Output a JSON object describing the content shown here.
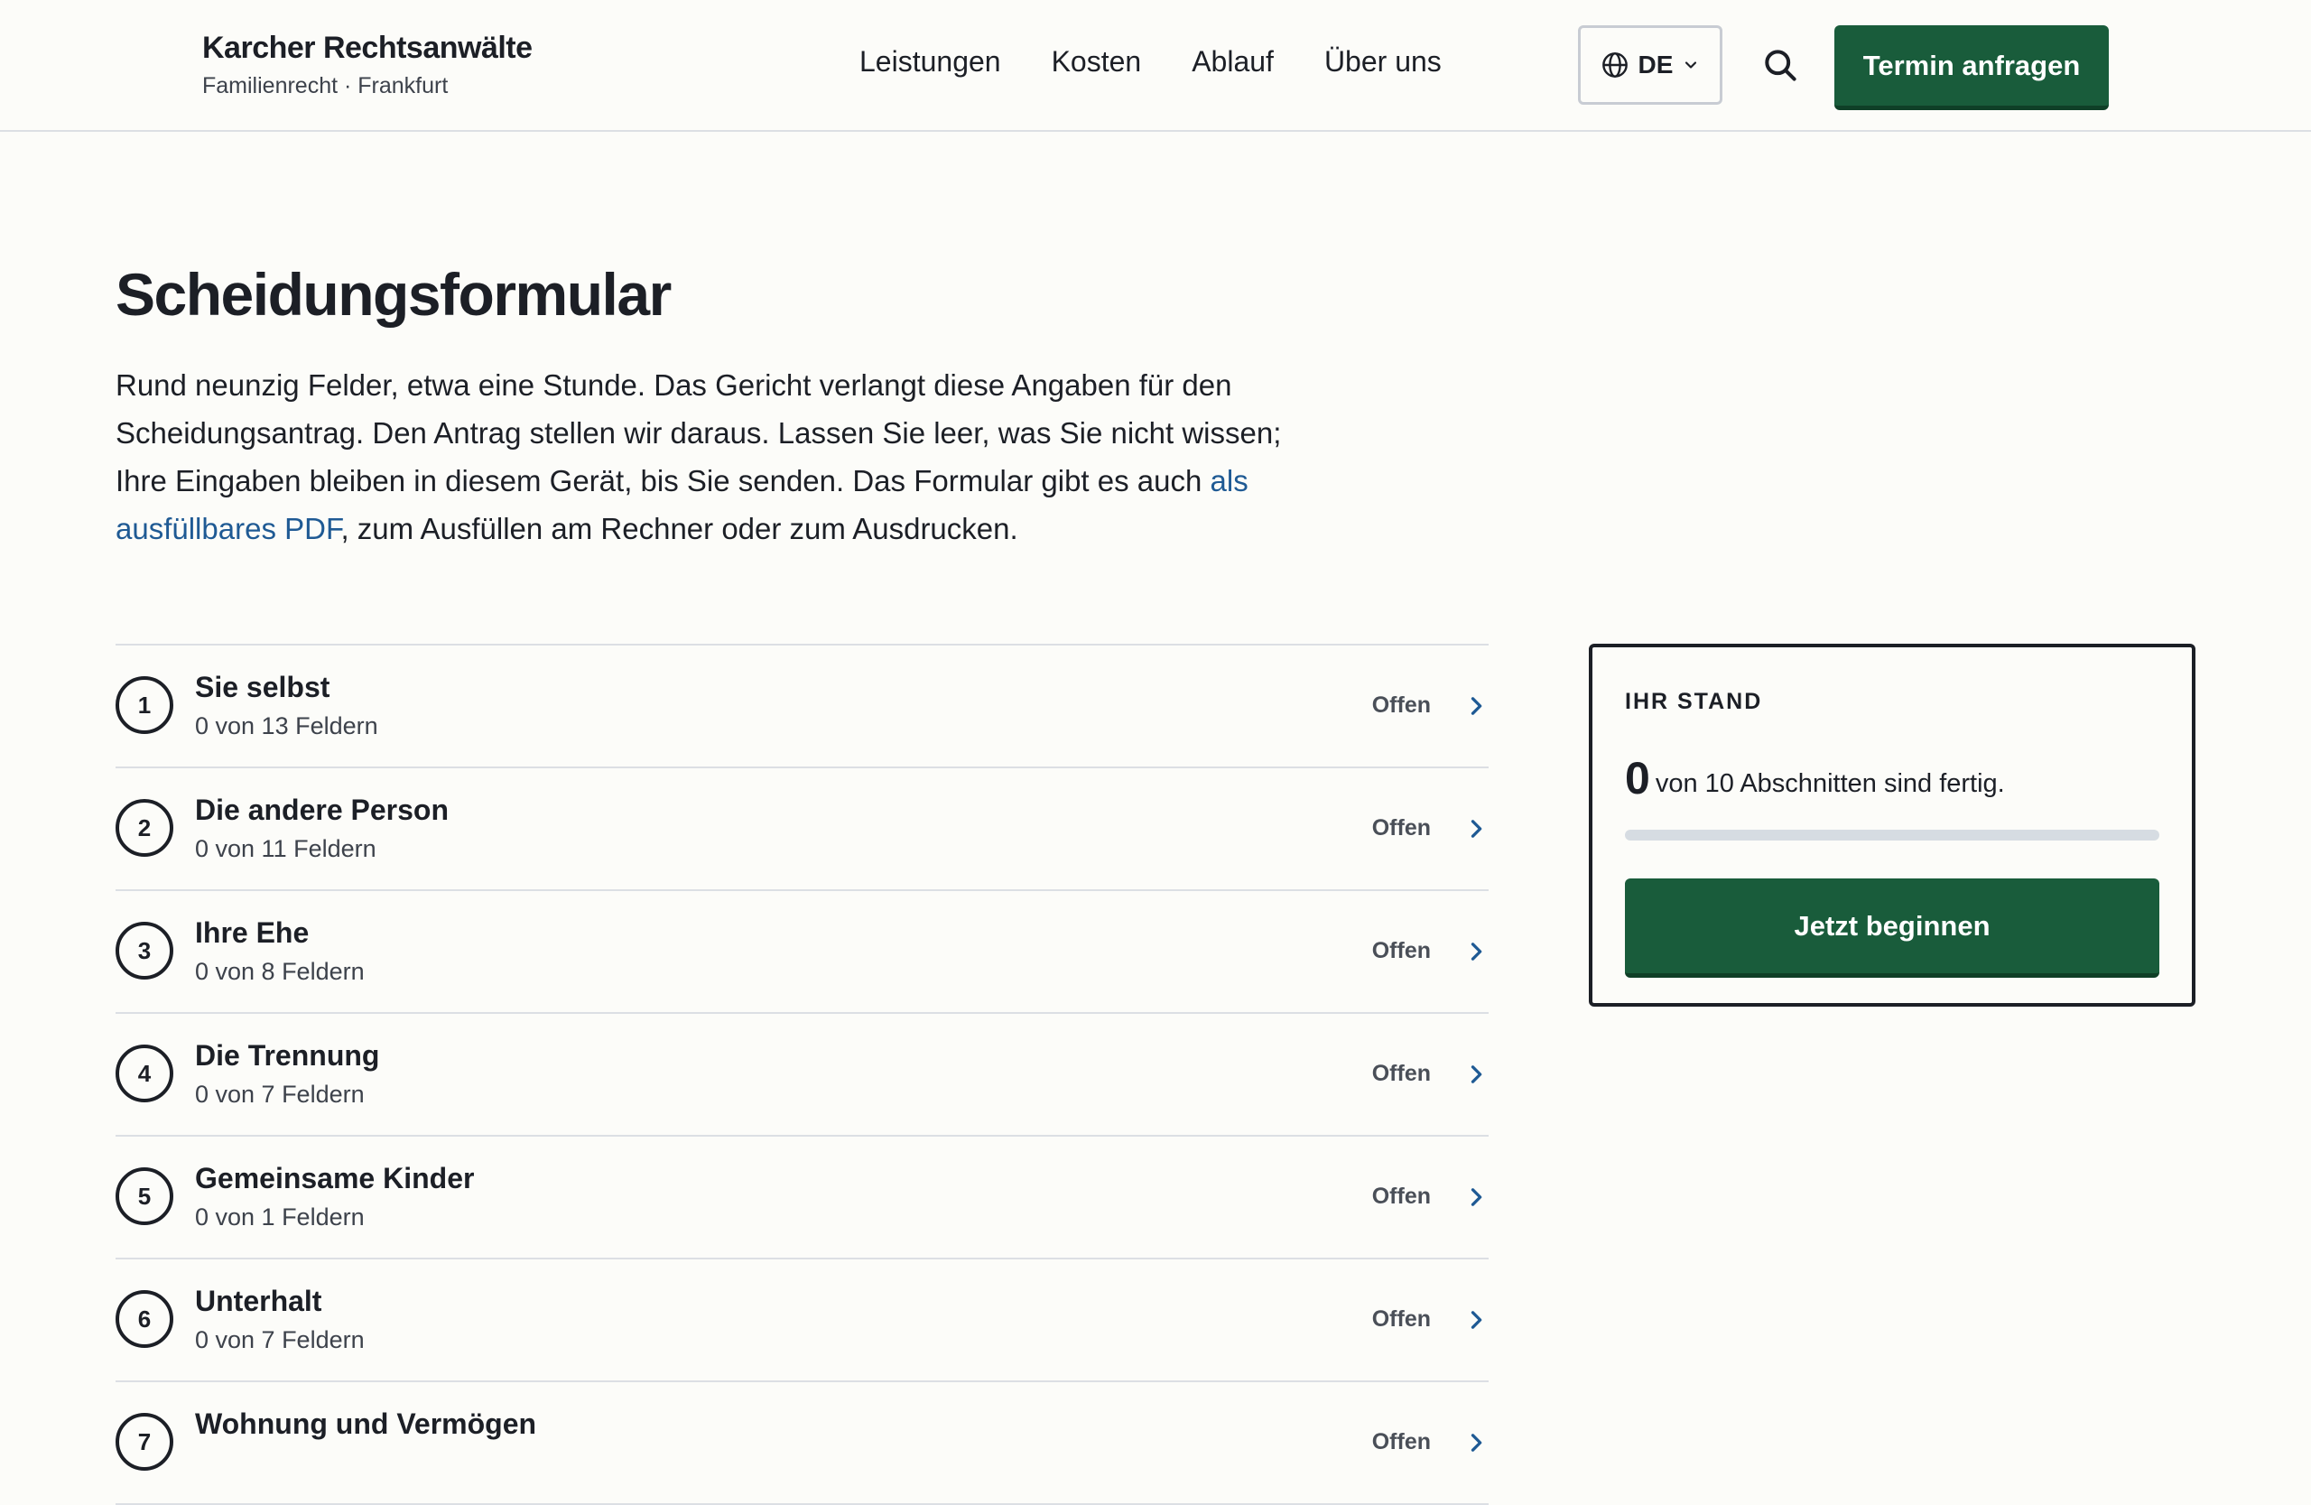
{
  "brand": {
    "name": "Karcher Rechtsanwälte",
    "subtitle": "Familienrecht · Frankfurt"
  },
  "nav": {
    "items": [
      "Leistungen",
      "Kosten",
      "Ablauf",
      "Über uns"
    ]
  },
  "language": {
    "selected": "DE",
    "icon": "globe-icon"
  },
  "search": {
    "icon": "search-icon"
  },
  "cta": {
    "label": "Termin anfragen"
  },
  "page": {
    "title": "Scheidungsformular",
    "intro_before_link": "Rund neunzig Felder, etwa eine Stunde. Das Gericht verlangt diese Angaben für den Scheidungsantrag. Den Antrag stellen wir daraus. Lassen Sie leer, was Sie nicht wissen; Ihre Eingaben bleiben in diesem Gerät, bis Sie senden. Das Formular gibt es auch ",
    "intro_link": "als ausfüllbares PDF",
    "intro_after_link": ", zum Ausfüllen am Rechner oder zum Ausdrucken."
  },
  "sections": [
    {
      "number": "1",
      "title": "Sie selbst",
      "count": "0 von 13 Feldern",
      "status": "Offen"
    },
    {
      "number": "2",
      "title": "Die andere Person",
      "count": "0 von 11 Feldern",
      "status": "Offen"
    },
    {
      "number": "3",
      "title": "Ihre Ehe",
      "count": "0 von 8 Feldern",
      "status": "Offen"
    },
    {
      "number": "4",
      "title": "Die Trennung",
      "count": "0 von 7 Feldern",
      "status": "Offen"
    },
    {
      "number": "5",
      "title": "Gemeinsame Kinder",
      "count": "0 von 1 Feldern",
      "status": "Offen"
    },
    {
      "number": "6",
      "title": "Unterhalt",
      "count": "0 von 7 Feldern",
      "status": "Offen"
    },
    {
      "number": "7",
      "title": "Wohnung und Vermögen",
      "count": "",
      "status": "Offen"
    }
  ],
  "stand": {
    "label": "IHR STAND",
    "done": "0",
    "text": "von 10 Abschnitten sind fertig.",
    "progress": 0,
    "button": "Jetzt beginnen"
  },
  "colors": {
    "accent": "#195c3b",
    "link": "#1f5a94",
    "background": "#fcfcf9"
  }
}
